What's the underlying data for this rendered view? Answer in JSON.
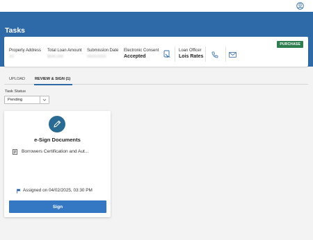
{
  "header": {
    "user_icon": "user-circle-icon"
  },
  "page": {
    "title": "Tasks"
  },
  "summary": {
    "badge": "PURCHASE",
    "property_address": {
      "label": "Property Address",
      "value": "XX"
    },
    "total_loan_amount": {
      "label": "Total Loan Amount",
      "value": "$000,000"
    },
    "submission_date": {
      "label": "Submission Date",
      "value": "04/02/2025"
    },
    "electronic_consent": {
      "label": "Electronic Consent",
      "value": "Accepted",
      "icon": "document-touch-icon"
    },
    "loan_officer": {
      "label": "Loan Officer",
      "value": "Lois Rates"
    },
    "actions": {
      "phone_icon": "phone-icon",
      "email_icon": "email-icon"
    }
  },
  "tabs": [
    {
      "label": "UPLOAD",
      "active": false
    },
    {
      "label": "REVIEW & SIGN (1)",
      "active": true
    }
  ],
  "filter": {
    "label": "Task Status",
    "selected": "Pending"
  },
  "task_card": {
    "icon": "pen-icon",
    "title": "e-Sign Documents",
    "document_name": "Borrowers Certification and Aut...",
    "assigned": "Assigned on 04/02/2025, 03:30 PM",
    "button_label": "Sign"
  },
  "colors": {
    "primary": "#2e6aa8",
    "badge_green": "#2e7d4f",
    "icon_teal": "#2a6b93",
    "button_blue": "#3478c4",
    "flag_blue": "#1f5fa3"
  }
}
